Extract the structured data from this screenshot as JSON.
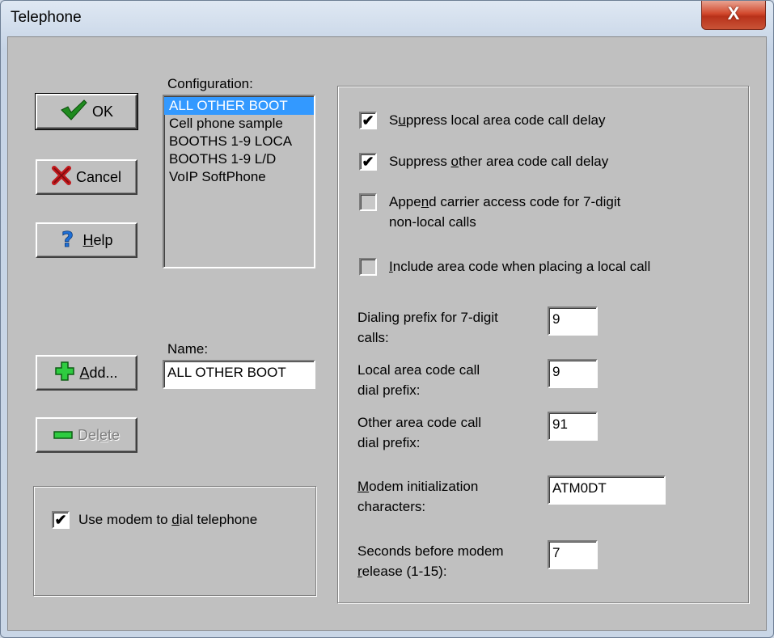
{
  "window": {
    "title": "Telephone",
    "close_glyph": "X"
  },
  "buttons": {
    "ok": {
      "label": "OK",
      "icon": "checkmark-icon"
    },
    "cancel": {
      "label": "Cancel",
      "icon": "x-icon"
    },
    "help": {
      "label_mnemonic": "H",
      "label_rest": "elp",
      "icon": "question-icon"
    },
    "add": {
      "label_mnemonic": "A",
      "label_rest": "dd...",
      "icon": "plus-icon"
    },
    "delete": {
      "label_pre": "Del",
      "label_mnemonic": "e",
      "label_rest": "te",
      "icon": "minus-icon",
      "disabled": true
    }
  },
  "configuration": {
    "label": "Configuration:",
    "items": [
      "ALL OTHER BOOT",
      "Cell phone sample",
      "BOOTHS 1-9 LOCA",
      "BOOTHS 1-9 L/D",
      "VoIP SoftPhone"
    ],
    "selected_index": 0
  },
  "name": {
    "label": "Name:",
    "value": "ALL OTHER BOOT"
  },
  "modem_group": {
    "use_modem": {
      "checked": true,
      "label_pre": "Use modem to ",
      "label_mnemonic": "d",
      "label_rest": "ial telephone"
    }
  },
  "options": {
    "suppress_local": {
      "checked": true,
      "label_pre": "S",
      "label_mnemonic": "u",
      "label_rest": "ppress local area code call delay"
    },
    "suppress_other": {
      "checked": true,
      "label_pre": "Suppress ",
      "label_mnemonic": "o",
      "label_rest": "ther area code call delay"
    },
    "append_carrier": {
      "checked": false,
      "line1_pre": "Appe",
      "line1_mnemonic": "n",
      "line1_rest": "d carrier access code for 7-digit",
      "line2": "non-local calls"
    },
    "include_area": {
      "checked": false,
      "label_mnemonic": "I",
      "label_rest": "nclude area code when placing a local call"
    }
  },
  "fields": {
    "dialing_prefix": {
      "line1": "Dialing prefix for 7-digit",
      "line2": "calls:",
      "value": "9"
    },
    "local_prefix": {
      "line1": "Local area code call",
      "line2": "dial prefix:",
      "value": "9"
    },
    "other_prefix": {
      "line1": "Other area code call",
      "line2": "dial prefix:",
      "value": "91"
    },
    "modem_init": {
      "line1_mnemonic": "M",
      "line1_rest": "odem initialization",
      "line2": "characters:",
      "value": "ATM0DT"
    },
    "seconds_release": {
      "line1": "Seconds before modem",
      "line2_mnemonic": "r",
      "line2_rest": "elease (1-15):",
      "value": "7"
    }
  },
  "colors": {
    "selection": "#3399ff",
    "dialog_face": "#c0c0c0"
  }
}
